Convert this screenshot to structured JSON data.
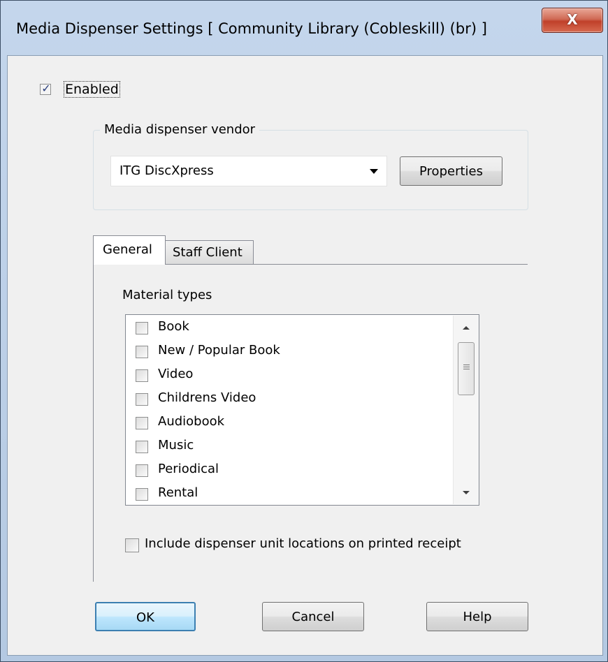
{
  "window": {
    "title": "Media Dispenser Settings [ Community Library (Cobleskill) (br) ]",
    "close_glyph": "X"
  },
  "enabled": {
    "label": "Enabled",
    "checked": true
  },
  "vendor_group": {
    "label": "Media dispenser vendor",
    "selected": "ITG DiscXpress",
    "properties_label": "Properties"
  },
  "tabs": [
    {
      "label": "General",
      "active": true
    },
    {
      "label": "Staff Client",
      "active": false
    }
  ],
  "material_types": {
    "label": "Material types",
    "items": [
      {
        "label": "Book",
        "checked": false
      },
      {
        "label": "New / Popular Book",
        "checked": false
      },
      {
        "label": "Video",
        "checked": false
      },
      {
        "label": "Childrens Video",
        "checked": false
      },
      {
        "label": "Audiobook",
        "checked": false
      },
      {
        "label": "Music",
        "checked": false
      },
      {
        "label": "Periodical",
        "checked": false
      },
      {
        "label": "Rental",
        "checked": false
      }
    ]
  },
  "receipt": {
    "label": "Include dispenser unit locations on printed receipt",
    "checked": false
  },
  "buttons": {
    "ok": "OK",
    "cancel": "Cancel",
    "help": "Help"
  }
}
